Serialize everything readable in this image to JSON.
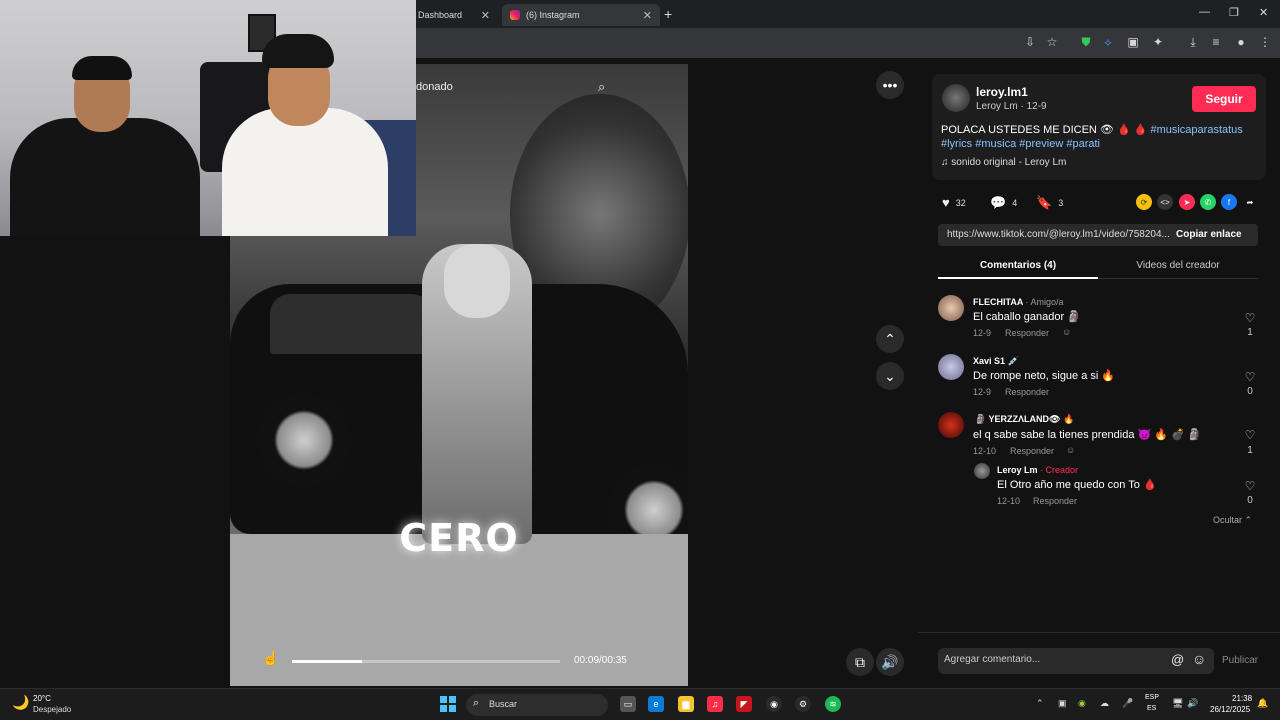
{
  "browser": {
    "tabs": [
      {
        "label": "Dashboard",
        "close": "✕"
      },
      {
        "label": "(6) Instagram",
        "close": "✕"
      }
    ],
    "new_tab": "+",
    "window_controls": [
      "—",
      "❐",
      "✕"
    ]
  },
  "video": {
    "search_placeholder": "donado",
    "overlay_text": "CERO",
    "time": "00:09/00:35",
    "progress": 0.26
  },
  "post": {
    "username": "leroy.lm1",
    "meta": "Leroy Lm · 12-9",
    "follow_label": "Seguir",
    "caption_text": "POLACA USTEDES ME DICEN 👁 🩸 🩸",
    "hashtags": [
      "#musicaparastatus",
      "#lyrics",
      "#musica",
      "#preview",
      "#parati"
    ],
    "sound": "sonido original - Leroy Lm",
    "likes": "32",
    "comments": "4",
    "saves": "3",
    "link": "https://www.tiktok.com/@leroy.lm1/video/758204...",
    "copy_label": "Copiar enlace"
  },
  "tabs": {
    "comments": "Comentarios (4)",
    "videos": "Videos del creador"
  },
  "comments": [
    {
      "name": "FLECHITAA",
      "badge": "· Amigo/a",
      "text": "El caballo ganador 🗿",
      "date": "12-9",
      "reply": "Responder",
      "likes": "1"
    },
    {
      "name": "Xavi S1 💉",
      "badge": "",
      "text": "De rompe neto, sigue a si 🔥",
      "date": "12-9",
      "reply": "Responder",
      "likes": "0"
    },
    {
      "name": "🗿 YERZZΛLAND👁 🔥",
      "badge": "",
      "text": "el q sabe sabe la tienes prendida 👿 🔥 💣 🗿",
      "date": "12-10",
      "reply": "Responder",
      "likes": "1"
    },
    {
      "name": "Leroy Lm",
      "badge": "· Creador",
      "text": "El Otro año me quedo con To 🩸",
      "date": "12-10",
      "reply": "Responder",
      "likes": "0"
    }
  ],
  "hide_label": "Ocultar ⌃",
  "composer": {
    "placeholder": "Agregar comentario...",
    "publish": "Publicar"
  },
  "taskbar": {
    "temp": "20°C",
    "weather": "Despejado",
    "search": "Buscar",
    "lang1": "ESP",
    "lang2": "ES",
    "time": "21:38",
    "date": "26/12/2025"
  },
  "colors": {
    "accent": "#fe2c55",
    "hashtag": "#8bc1ff"
  }
}
